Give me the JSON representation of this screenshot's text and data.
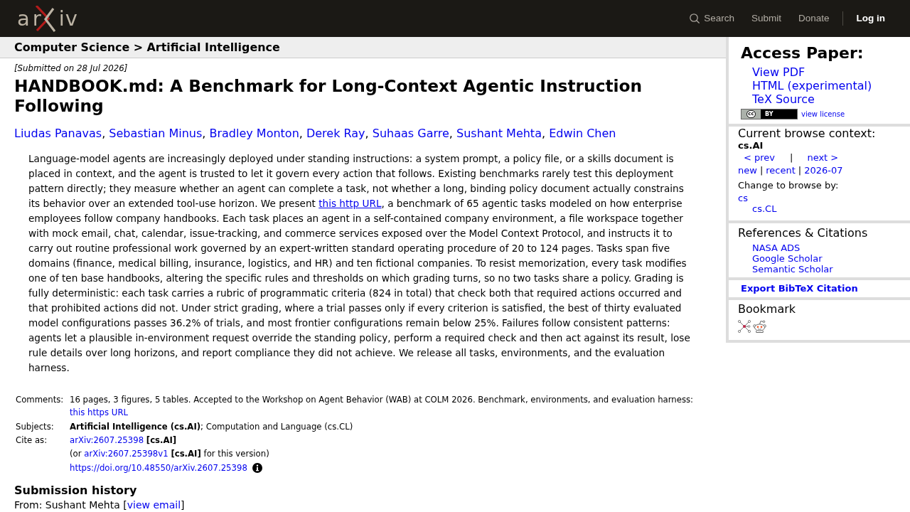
{
  "header": {
    "logo": {
      "left": "ar",
      "right": "iv"
    },
    "nav": [
      {
        "kind": "search",
        "label": "Search"
      },
      {
        "kind": "link",
        "label": "Submit"
      },
      {
        "kind": "link",
        "label": "Donate"
      },
      {
        "kind": "login",
        "label": "Log in"
      }
    ]
  },
  "breadcrumb": "Computer Science > Artificial Intelligence",
  "paper": {
    "submitted": "[Submitted on 28 Jul 2026]",
    "title": "HANDBOOK.md: A Benchmark for Long-Context Agentic Instruction Following",
    "authors": [
      "Liudas Panavas",
      "Sebastian Minus",
      "Bradley Monton",
      "Derek Ray",
      "Suhaas Garre",
      "Sushant Mehta",
      "Edwin Chen"
    ],
    "author_separator": ",",
    "abstract": {
      "before": "Language-model agents are increasingly deployed under standing instructions: a system prompt, a policy file, or a skills document is placed in context, and the agent is trusted to let it govern every action that follows. Existing benchmarks rarely test this deployment pattern directly; they measure whether an agent can complete a task, not whether a long, binding policy document actually constrains its behavior over an extended tool-use horizon. We present",
      "link": "this http URL",
      "after": ", a benchmark of 65 agentic tasks modeled on how enterprise employees follow company handbooks. Each task places an agent in a self-contained company environment, a file workspace together with mock email, chat, calendar, issue-tracking, and commerce services exposed over the Model Context Protocol, and instructs it to carry out routine professional work governed by an expert-written standard operating procedure of 20 to 124 pages. Tasks span five domains (finance, medical billing, insurance, logistics, and HR) and ten fictional companies. To resist memorization, every task modifies one of ten base handbooks, altering the specific rules and thresholds on which grading turns, so no two tasks share a policy. Grading is fully deterministic: each task carries a rubric of programmatic criteria (824 in total) that check both that required actions occurred and that prohibited actions did not. Under strict grading, where a trial passes only if every criterion is satisfied, the best of thirty evaluated model configurations passes 36.2% of trials, and most frontier configurations remain below 25%. Failures follow consistent patterns: agents let a plausible in-environment request override the standing policy, perform a required check and then act against its result, lose rule details over long horizons, and report compliance they did not achieve. We release all tasks, environments, and the evaluation harness."
    },
    "metadata": {
      "comments": {
        "label": "Comments:",
        "text": "16 pages, 3 figures, 5 tables. Accepted to the Workshop on Agent Behavior (WAB) at COLM 2026. Benchmark, environments, and evaluation harness:",
        "link": "this https URL"
      },
      "subjects": {
        "label": "Subjects:",
        "text": "**Artificial Intelligence (cs.AI)**; Computation and Language (cs.CL)"
      },
      "cite_as": {
        "label": "Cite as:",
        "id": "arXiv:2607.25398",
        "tag": "[cs.AI]",
        "version": {
          "before": "(or",
          "link": "arXiv:2607.25398v1",
          "after": "**[cs.AI]** for this version)"
        },
        "doi": "https://doi.org/10.48550/arXiv.2607.25398"
      }
    },
    "submission_history": {
      "heading": "Submission history",
      "from": {
        "before": "From: Sushant Mehta [",
        "link": "view email",
        "after": "]"
      }
    }
  },
  "sidebar": {
    "access": {
      "heading": "Access Paper:",
      "links": [
        "View PDF",
        "HTML (experimental)",
        "TeX Source"
      ],
      "license": {
        "symbol": "cc",
        "label": "BY",
        "link": "view license"
      }
    },
    "browse": {
      "heading": "Current browse context:",
      "category": "cs.AI",
      "prev": "< prev",
      "next": "next >",
      "separator": "|",
      "listings": [
        "new",
        "recent",
        "2026-07"
      ],
      "change_heading": "Change to browse by:",
      "categories": [
        {
          "label": "cs",
          "children": [
            {
              "label": "cs.CL"
            }
          ]
        }
      ]
    },
    "references": {
      "heading": "References & Citations",
      "links": [
        "NASA ADS",
        "Google Scholar",
        "Semantic Scholar"
      ]
    },
    "export": "Export BibTeX Citation",
    "bookmark": {
      "heading": "Bookmark"
    }
  }
}
